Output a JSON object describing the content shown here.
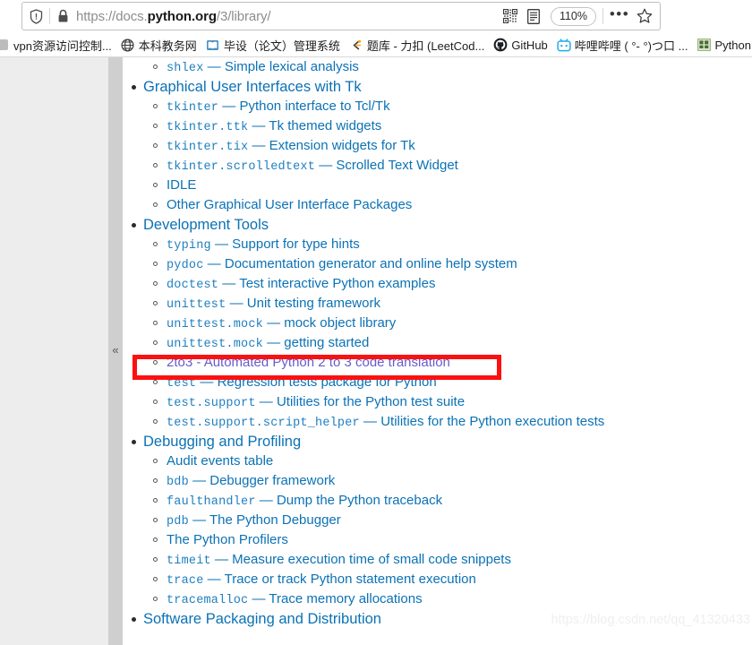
{
  "browser": {
    "url_full": "https://docs.python.org/3/library/",
    "url_prefix": "https://docs.",
    "url_host_strong": "python.org",
    "url_suffix": "/3/library/",
    "shield_icon": "shield-icon",
    "lock_icon": "padlock-icon",
    "qr_icon": "qr-code-icon",
    "reader_icon": "reader-mode-icon",
    "zoom_level": "110%",
    "ellipsis_label": "•••",
    "star_icon": "star-bookmark-icon"
  },
  "bookmarks": [
    {
      "label": "vpn资源访问控制...",
      "icon": "generic-site-icon"
    },
    {
      "label": "本科教务网",
      "icon": "globe-icon"
    },
    {
      "label": "毕设（论文）管理系统",
      "icon": "book-icon"
    },
    {
      "label": "题库 - 力扣 (LeetCod...",
      "icon": "leetcode-icon"
    },
    {
      "label": "GitHub",
      "icon": "github-icon"
    },
    {
      "label": "哔哩哔哩 ( °- °)つ口 ...",
      "icon": "bilibili-icon"
    },
    {
      "label": "Python prin",
      "icon": "python-doc-icon"
    }
  ],
  "sidebar": {
    "collapse_label": "«"
  },
  "toc": {
    "leading_item": {
      "mono": "shlex",
      "dash": " — ",
      "text": "Simple lexical analysis"
    },
    "sections": [
      {
        "title": "Graphical User Interfaces with Tk",
        "items": [
          {
            "mono": "tkinter",
            "dash": " — ",
            "text": "Python interface to Tcl/Tk"
          },
          {
            "mono": "tkinter.ttk",
            "dash": " — ",
            "text": "Tk themed widgets"
          },
          {
            "mono": "tkinter.tix",
            "dash": " — ",
            "text": "Extension widgets for Tk"
          },
          {
            "mono": "tkinter.scrolledtext",
            "dash": " — ",
            "text": "Scrolled Text Widget"
          },
          {
            "mono": "",
            "dash": "",
            "text": "IDLE"
          },
          {
            "mono": "",
            "dash": "",
            "text": "Other Graphical User Interface Packages"
          }
        ]
      },
      {
        "title": "Development Tools",
        "items": [
          {
            "mono": "typing",
            "dash": " — ",
            "text": "Support for type hints"
          },
          {
            "mono": "pydoc",
            "dash": " — ",
            "text": "Documentation generator and online help system"
          },
          {
            "mono": "doctest",
            "dash": " — ",
            "text": "Test interactive Python examples"
          },
          {
            "mono": "unittest",
            "dash": " — ",
            "text": "Unit testing framework"
          },
          {
            "mono": "unittest.mock",
            "dash": " — ",
            "text": "mock object library"
          },
          {
            "mono": "unittest.mock",
            "dash": " — ",
            "text": "getting started"
          },
          {
            "mono": "",
            "dash": "",
            "text": "2to3 - Automated Python 2 to 3 code translation",
            "visited": true,
            "highlighted": true
          },
          {
            "mono": "test",
            "dash": " — ",
            "text": "Regression tests package for Python"
          },
          {
            "mono": "test.support",
            "dash": " — ",
            "text": "Utilities for the Python test suite"
          },
          {
            "mono": "test.support.script_helper",
            "dash": " — ",
            "text": "Utilities for the Python execution tests"
          }
        ]
      },
      {
        "title": "Debugging and Profiling",
        "items": [
          {
            "mono": "",
            "dash": "",
            "text": "Audit events table"
          },
          {
            "mono": "bdb",
            "dash": " — ",
            "text": "Debugger framework"
          },
          {
            "mono": "faulthandler",
            "dash": " — ",
            "text": "Dump the Python traceback"
          },
          {
            "mono": "pdb",
            "dash": " — ",
            "text": "The Python Debugger"
          },
          {
            "mono": "",
            "dash": "",
            "text": "The Python Profilers"
          },
          {
            "mono": "timeit",
            "dash": " — ",
            "text": "Measure execution time of small code snippets"
          },
          {
            "mono": "trace",
            "dash": " — ",
            "text": "Trace or track Python statement execution"
          },
          {
            "mono": "tracemalloc",
            "dash": " — ",
            "text": "Trace memory allocations"
          }
        ]
      },
      {
        "title": "Software Packaging and Distribution",
        "items": []
      }
    ]
  },
  "annotation": {
    "highlight_color": "#fc1010",
    "target_text": "2to3 - Automated Python 2 to 3 code translation"
  },
  "watermark": {
    "text": "https://blog.csdn.net/qq_41320433"
  },
  "colors": {
    "link": "#0b72b5",
    "link_mono": "#1f7fc0",
    "visited_link": "#6a5acd",
    "sidebar_bg": "#ededed",
    "handle_bg": "#cfcfcf",
    "highlight": "#fc1010"
  }
}
